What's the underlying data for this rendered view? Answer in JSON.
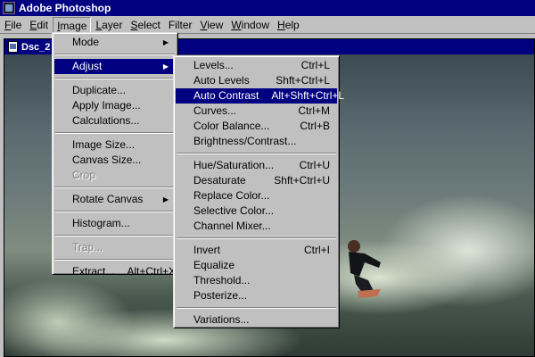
{
  "app": {
    "title": "Adobe Photoshop"
  },
  "menubar": {
    "items": [
      {
        "label": "File",
        "ul": "F",
        "rest": "ile"
      },
      {
        "label": "Edit",
        "ul": "E",
        "rest": "dit"
      },
      {
        "label": "Image",
        "ul": "I",
        "rest": "mage"
      },
      {
        "label": "Layer",
        "ul": "L",
        "rest": "ayer"
      },
      {
        "label": "Select",
        "ul": "S",
        "rest": "elect"
      },
      {
        "label": "Filter",
        "ul": "",
        "rest": "Filter"
      },
      {
        "label": "View",
        "ul": "V",
        "rest": "iew"
      },
      {
        "label": "Window",
        "ul": "W",
        "rest": "indow"
      },
      {
        "label": "Help",
        "ul": "H",
        "rest": "elp"
      }
    ]
  },
  "document": {
    "title": "Dsc_2"
  },
  "image_menu": {
    "mode": "Mode",
    "adjust": "Adjust",
    "duplicate": "Duplicate...",
    "apply_image": "Apply Image...",
    "calculations": "Calculations...",
    "image_size": "Image Size...",
    "canvas_size": "Canvas Size...",
    "crop": "Crop",
    "rotate_canvas": "Rotate Canvas",
    "histogram": "Histogram...",
    "trap": "Trap...",
    "extract": "Extract...",
    "extract_shortcut": "Alt+Ctrl+X"
  },
  "adjust_menu": {
    "levels": "Levels...",
    "levels_sc": "Ctrl+L",
    "auto_levels": "Auto Levels",
    "auto_levels_sc": "Shft+Ctrl+L",
    "auto_contrast": "Auto Contrast",
    "auto_contrast_sc": "Alt+Shft+Ctrl+L",
    "curves": "Curves...",
    "curves_sc": "Ctrl+M",
    "color_balance": "Color Balance...",
    "color_balance_sc": "Ctrl+B",
    "brightness_contrast": "Brightness/Contrast...",
    "hue_saturation": "Hue/Saturation...",
    "hue_saturation_sc": "Ctrl+U",
    "desaturate": "Desaturate",
    "desaturate_sc": "Shft+Ctrl+U",
    "replace_color": "Replace Color...",
    "selective_color": "Selective Color...",
    "channel_mixer": "Channel Mixer...",
    "invert": "Invert",
    "invert_sc": "Ctrl+I",
    "equalize": "Equalize",
    "threshold": "Threshold...",
    "posterize": "Posterize...",
    "variations": "Variations..."
  },
  "colors": {
    "titlebar": "#000080",
    "menu_bg": "#c0c0c0",
    "highlight": "#000080"
  }
}
